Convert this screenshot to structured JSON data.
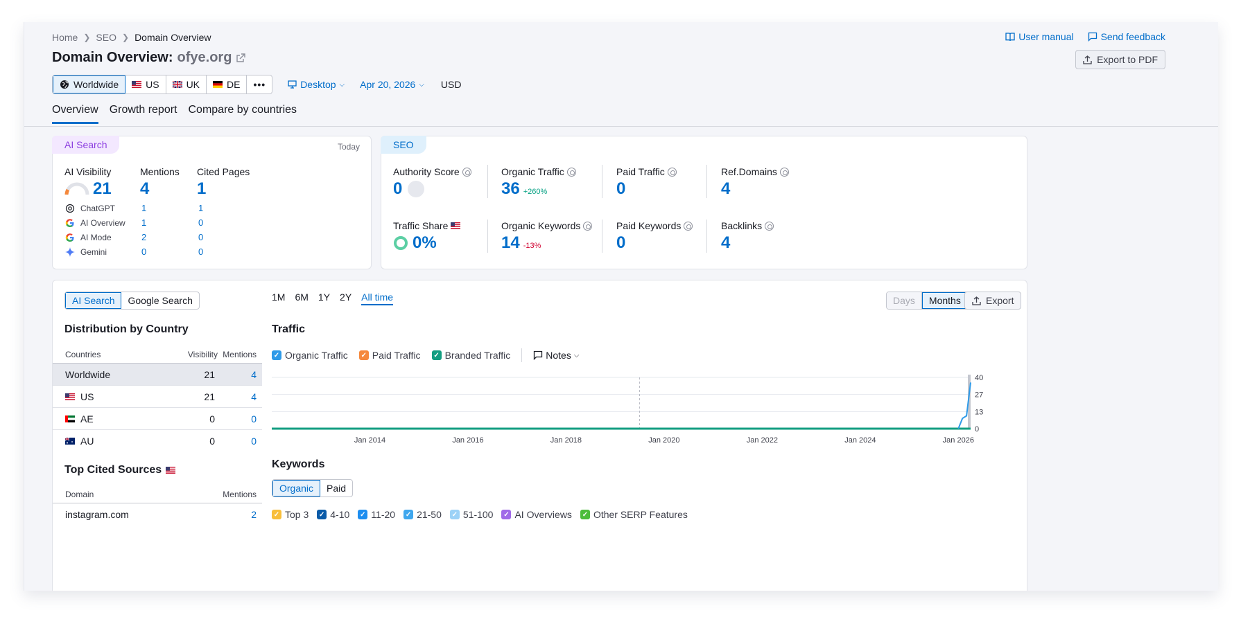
{
  "breadcrumb": [
    "Home",
    "SEO",
    "Domain Overview"
  ],
  "title": "Domain Overview:",
  "domain": "ofye.org",
  "links": {
    "manual": "User manual",
    "feedback": "Send feedback"
  },
  "export_pdf": "Export to PDF",
  "regions": [
    {
      "label": "Worldwide",
      "active": true
    },
    {
      "label": "US",
      "active": false
    },
    {
      "label": "UK",
      "active": false
    },
    {
      "label": "DE",
      "active": false
    }
  ],
  "device": "Desktop",
  "date": "Apr 20, 2026",
  "currency": "USD",
  "tabs": [
    "Overview",
    "Growth report",
    "Compare by countries"
  ],
  "ai_card": {
    "pill": "AI Search",
    "today": "Today",
    "headers": [
      "AI Visibility",
      "Mentions",
      "Cited Pages"
    ],
    "visibility": "21",
    "mentions": "4",
    "cited": "1",
    "sources": [
      {
        "name": "ChatGPT",
        "mentions": "1",
        "cited": "1",
        "icon": "chatgpt-icon"
      },
      {
        "name": "AI Overview",
        "mentions": "1",
        "cited": "0",
        "icon": "google-icon"
      },
      {
        "name": "AI Mode",
        "mentions": "2",
        "cited": "0",
        "icon": "google-icon"
      },
      {
        "name": "Gemini",
        "mentions": "0",
        "cited": "0",
        "icon": "gemini-icon"
      }
    ]
  },
  "seo_card": {
    "pill": "SEO",
    "authority": {
      "label": "Authority Score",
      "value": "0"
    },
    "organic_traffic": {
      "label": "Organic Traffic",
      "value": "36",
      "delta": "+260%"
    },
    "paid_traffic": {
      "label": "Paid Traffic",
      "value": "0"
    },
    "ref_domains": {
      "label": "Ref.Domains",
      "value": "4"
    },
    "traffic_share": {
      "label": "Traffic Share",
      "value": "0%"
    },
    "organic_keywords": {
      "label": "Organic Keywords",
      "value": "14",
      "delta": "-13%"
    },
    "paid_keywords": {
      "label": "Paid Keywords",
      "value": "0"
    },
    "backlinks": {
      "label": "Backlinks",
      "value": "4"
    }
  },
  "main": {
    "toggle": [
      "AI Search",
      "Google Search"
    ],
    "distribution_title": "Distribution by Country",
    "dist_headers": [
      "Countries",
      "Visibility",
      "Mentions"
    ],
    "dist_rows": [
      {
        "country": "Worldwide",
        "visibility": "21",
        "mentions": "4"
      },
      {
        "country": "US",
        "visibility": "21",
        "mentions": "4"
      },
      {
        "country": "AE",
        "visibility": "0",
        "mentions": "0"
      },
      {
        "country": "AU",
        "visibility": "0",
        "mentions": "0"
      }
    ],
    "top_cited_title": "Top Cited Sources",
    "cited_headers": [
      "Domain",
      "Mentions"
    ],
    "cited_rows": [
      {
        "domain": "instagram.com",
        "mentions": "2"
      }
    ],
    "periods": [
      "1M",
      "6M",
      "1Y",
      "2Y",
      "All time"
    ],
    "active_period": "All time",
    "days": "Days",
    "months": "Months",
    "export": "Export",
    "traffic_title": "Traffic",
    "legend": [
      {
        "label": "Organic Traffic",
        "color": "#2e9ae8"
      },
      {
        "label": "Paid Traffic",
        "color": "#f5883c"
      },
      {
        "label": "Branded Traffic",
        "color": "#139e81"
      }
    ],
    "notes": "Notes",
    "keywords_title": "Keywords",
    "kw_toggle": [
      "Organic",
      "Paid"
    ],
    "kw_legend": [
      {
        "label": "Top 3",
        "color": "#f8be3a"
      },
      {
        "label": "4-10",
        "color": "#0a5ba8"
      },
      {
        "label": "11-20",
        "color": "#1d8ef0"
      },
      {
        "label": "21-50",
        "color": "#3fa7ee"
      },
      {
        "label": "51-100",
        "color": "#9cd2f7"
      },
      {
        "label": "AI Overviews",
        "color": "#a06ae8"
      },
      {
        "label": "Other SERP Features",
        "color": "#4cbd3b"
      }
    ]
  },
  "chart_data": {
    "type": "line",
    "y_ticks": [
      "40",
      "27",
      "13",
      "0"
    ],
    "x_ticks": [
      "Jan 2014",
      "Jan 2016",
      "Jan 2018",
      "Jan 2020",
      "Jan 2022",
      "Jan 2024",
      "Jan 2026"
    ],
    "ylim": [
      0,
      40
    ],
    "series": [
      {
        "name": "Organic Traffic",
        "color": "#2e9ae8",
        "x": [
          "Jan 2026",
          "Feb 2026",
          "Mar 2026",
          "Apr 2026"
        ],
        "values": [
          0,
          8,
          10,
          36
        ]
      },
      {
        "name": "Branded Traffic",
        "color": "#139e81",
        "x": [
          "Jan 2012",
          "Apr 2026"
        ],
        "values": [
          0,
          0
        ]
      }
    ]
  }
}
